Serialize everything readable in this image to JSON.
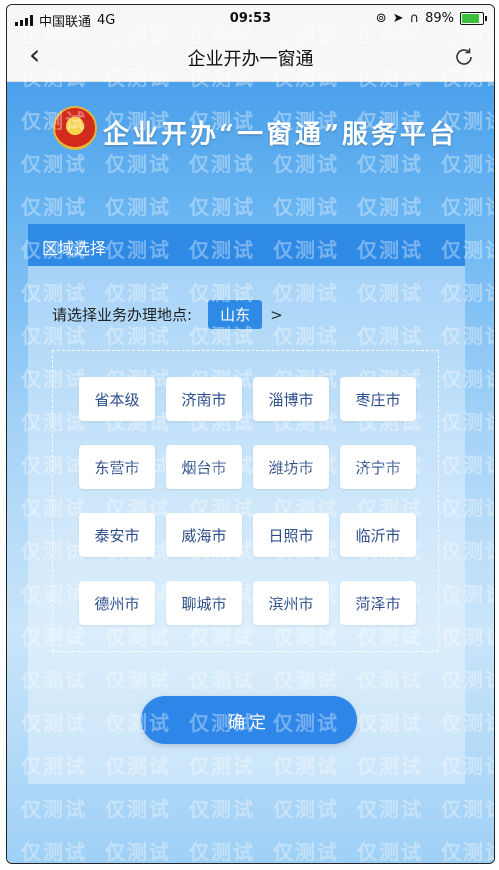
{
  "status_bar": {
    "carrier": "中国联通",
    "network": "4G",
    "time": "09:53",
    "battery_percent": "89%",
    "battery_level": 0.89,
    "icons": [
      "signal-icon",
      "lock-rotation-icon",
      "location-icon",
      "headphones-icon",
      "battery-icon"
    ]
  },
  "nav": {
    "title": "企业开办一窗通",
    "back_icon": "chevron-left-icon",
    "refresh_icon": "refresh-icon"
  },
  "banner": {
    "title": "企业开办“一窗通”服务平台",
    "emblem_icon": "national-emblem-icon"
  },
  "panel": {
    "header": "区域选择",
    "prompt": "请选择业务办理地点:",
    "province": "山东",
    "province_arrow": ">"
  },
  "cities": [
    [
      "省本级",
      "济南市",
      "淄博市",
      "枣庄市"
    ],
    [
      "东营市",
      "烟台市",
      "潍坊市",
      "济宁市"
    ],
    [
      "泰安市",
      "威海市",
      "日照市",
      "临沂市"
    ],
    [
      "德州市",
      "聊城市",
      "滨州市",
      "菏泽市"
    ]
  ],
  "confirm_label": "确定",
  "watermark_text": "仅测试",
  "colors": {
    "accent": "#2f8ae6",
    "confirm": "#2d86e8",
    "city_text": "#2c4d8a"
  }
}
